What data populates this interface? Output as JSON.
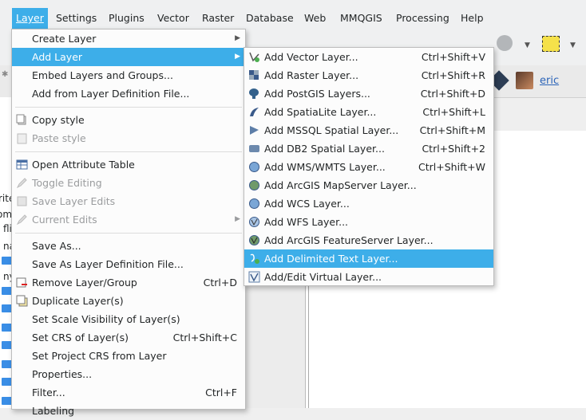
{
  "menubar": {
    "items": [
      {
        "label": "Layer",
        "active": true
      },
      {
        "label": "Settings"
      },
      {
        "label": "Plugins"
      },
      {
        "label": "Vector"
      },
      {
        "label": "Raster"
      },
      {
        "label": "Database"
      },
      {
        "label": "Web"
      },
      {
        "label": "MMQGIS"
      },
      {
        "label": "Processing"
      },
      {
        "label": "Help"
      }
    ]
  },
  "user": {
    "name": "eric"
  },
  "left_panel_fragments": [
    "rite",
    "om",
    "fli",
    "na",
    "ny"
  ],
  "layer_menu": {
    "items": [
      {
        "label": "Create Layer",
        "submenu": true
      },
      {
        "label": "Add Layer",
        "submenu": true,
        "highlighted": true
      },
      {
        "label": "Embed Layers and Groups..."
      },
      {
        "label": "Add from Layer Definition File..."
      },
      {
        "label": "Copy style",
        "icon": "copy-style-icon"
      },
      {
        "label": "Paste style",
        "icon": "paste-style-icon",
        "disabled": true
      },
      {
        "label": "Open Attribute Table",
        "icon": "attribute-table-icon"
      },
      {
        "label": "Toggle Editing",
        "icon": "pencil-icon",
        "disabled": true
      },
      {
        "label": "Save Layer Edits",
        "icon": "save-edits-icon",
        "disabled": true
      },
      {
        "label": "Current Edits",
        "icon": "current-edits-icon",
        "disabled": true,
        "submenu": true
      },
      {
        "label": "Save As..."
      },
      {
        "label": "Save As Layer Definition File..."
      },
      {
        "label": "Remove Layer/Group",
        "icon": "remove-layer-icon",
        "shortcut": "Ctrl+D"
      },
      {
        "label": "Duplicate Layer(s)",
        "icon": "duplicate-layer-icon"
      },
      {
        "label": "Set Scale Visibility of Layer(s)"
      },
      {
        "label": "Set CRS of Layer(s)",
        "shortcut": "Ctrl+Shift+C"
      },
      {
        "label": "Set Project CRS from Layer"
      },
      {
        "label": "Properties..."
      },
      {
        "label": "Filter...",
        "shortcut": "Ctrl+F"
      },
      {
        "label": "Labeling"
      }
    ]
  },
  "add_layer_menu": {
    "items": [
      {
        "label": "Add Vector Layer...",
        "shortcut": "Ctrl+Shift+V",
        "icon": "vector-layer-icon"
      },
      {
        "label": "Add Raster Layer...",
        "shortcut": "Ctrl+Shift+R",
        "icon": "raster-layer-icon"
      },
      {
        "label": "Add PostGIS Layers...",
        "shortcut": "Ctrl+Shift+D",
        "icon": "postgis-icon"
      },
      {
        "label": "Add SpatiaLite Layer...",
        "shortcut": "Ctrl+Shift+L",
        "icon": "spatialite-icon"
      },
      {
        "label": "Add MSSQL Spatial Layer...",
        "shortcut": "Ctrl+Shift+M",
        "icon": "mssql-icon"
      },
      {
        "label": "Add DB2 Spatial Layer...",
        "shortcut": "Ctrl+Shift+2",
        "icon": "db2-icon"
      },
      {
        "label": "Add WMS/WMTS Layer...",
        "shortcut": "Ctrl+Shift+W",
        "icon": "wms-globe-icon"
      },
      {
        "label": "Add ArcGIS MapServer Layer...",
        "icon": "arcgis-mapserver-icon"
      },
      {
        "label": "Add WCS Layer...",
        "icon": "wcs-globe-icon"
      },
      {
        "label": "Add WFS Layer...",
        "icon": "wfs-globe-icon"
      },
      {
        "label": "Add ArcGIS FeatureServer Layer...",
        "icon": "arcgis-featureserver-icon"
      },
      {
        "label": "Add Delimited Text Layer...",
        "icon": "delimited-text-icon",
        "highlighted": true
      },
      {
        "label": "Add/Edit Virtual Layer...",
        "icon": "virtual-layer-icon"
      }
    ]
  },
  "colors": {
    "highlight": "#3daee9",
    "menu_bg": "#fcfcfc",
    "disabled": "#9a9c9e"
  }
}
